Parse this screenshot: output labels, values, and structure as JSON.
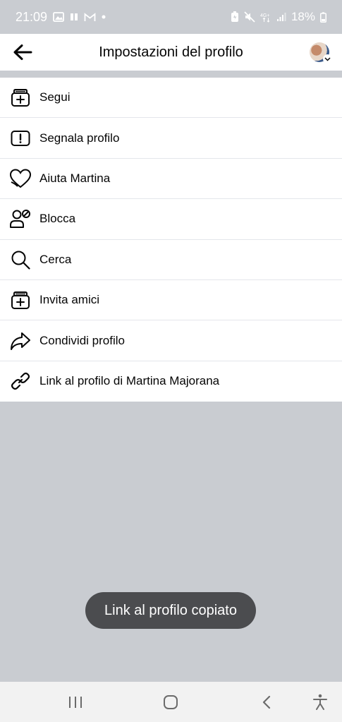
{
  "status_bar": {
    "time": "21:09",
    "battery_percent": "18%",
    "icons_left": [
      "image-icon",
      "pause-icon",
      "gmail-icon",
      "dot-icon"
    ],
    "icons_right": [
      "battery-saver-icon",
      "mute-icon",
      "network-4g-icon",
      "signal-icon",
      "battery-icon"
    ]
  },
  "header": {
    "title": "Impostazioni del profilo",
    "back_icon": "arrow-left-icon",
    "avatar_icon": "profile-avatar"
  },
  "menu": {
    "items": [
      {
        "label": "Segui",
        "icon": "follow-icon"
      },
      {
        "label": "Segnala profilo",
        "icon": "report-icon"
      },
      {
        "label": "Aiuta Martina",
        "icon": "heart-icon"
      },
      {
        "label": "Blocca",
        "icon": "block-user-icon"
      },
      {
        "label": "Cerca",
        "icon": "search-icon"
      },
      {
        "label": "Invita amici",
        "icon": "invite-icon"
      },
      {
        "label": "Condividi profilo",
        "icon": "share-icon"
      },
      {
        "label": "Link al profilo di Martina Majorana",
        "icon": "link-icon"
      }
    ]
  },
  "toast": {
    "text": "Link al profilo copiato"
  },
  "nav_bar": {
    "buttons": [
      "recent-apps-icon",
      "home-icon",
      "back-icon",
      "accessibility-icon"
    ]
  },
  "colors": {
    "background_overlay": "#c9ccd1",
    "surface": "#ffffff",
    "text": "#050505",
    "divider": "#e4e6eb",
    "toast_bg": "#4b4c4f"
  }
}
